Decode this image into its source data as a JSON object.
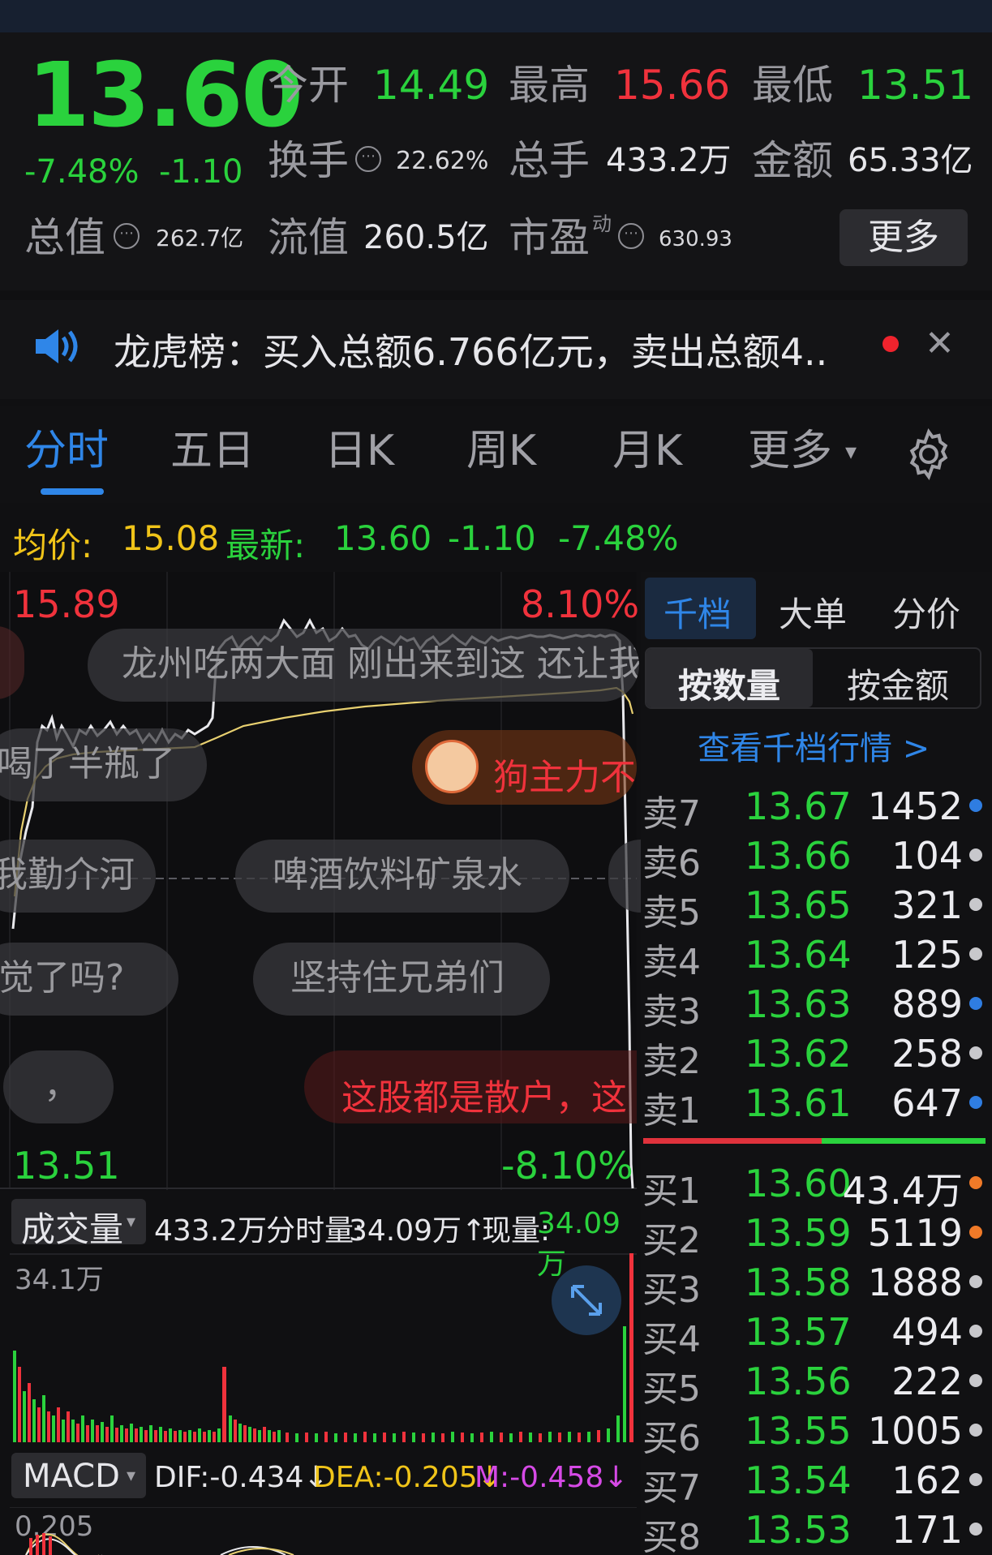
{
  "quote": {
    "price": "13.60",
    "change_pct": "-7.48%",
    "change_abs": "-1.10",
    "open_label": "今开",
    "open_value": "14.49",
    "high_label": "最高",
    "high_value": "15.66",
    "low_label": "最低",
    "low_value": "13.51",
    "turnover_label": "换手",
    "turnover_value": "22.62%",
    "volume_label": "总手",
    "volume_value": "433.2万",
    "amount_label": "金额",
    "amount_value": "65.33亿",
    "mktcap_label": "总值",
    "mktcap_value": "262.7亿",
    "float_label": "流值",
    "float_value": "260.5亿",
    "pe_label": "市盈",
    "pe_sup": "动",
    "pe_value": "630.93",
    "more_label": "更多",
    "info_glyph": "⋯"
  },
  "notice": {
    "text": "龙虎榜：买入总额6.766亿元，卖出总额4..",
    "close": "✕"
  },
  "tabs": [
    "分时",
    "五日",
    "日K",
    "周K",
    "月K",
    "更多"
  ],
  "tab_more_caret": "▾",
  "avg_row": {
    "avg_label": "均价:",
    "avg_value": "15.08",
    "latest_label": "最新:",
    "latest_value": "13.60",
    "latest_change": "-1.10",
    "latest_pct": "-7.48%"
  },
  "chart": {
    "top_price": "15.89",
    "top_pct": "8.10%",
    "bottom_price": "13.51",
    "bottom_pct": "-8.10%"
  },
  "danmaku": [
    "龙州吃两大面 刚出来到这 还让我",
    "喝了半瓶了",
    "狗主力不",
    "我勤介河",
    "啤酒饮料矿泉水",
    "觉了吗?",
    "坚持住兄弟们",
    "，",
    "这股都是散户，这"
  ],
  "volume": {
    "selector": "成交量",
    "caret": "▾",
    "total": "433.2万",
    "minute_label": "分时量:",
    "minute_value": "34.09万↑",
    "now_label": "现量:",
    "now_value": "34.09万",
    "axis_max": "34.1万"
  },
  "macd": {
    "selector": "MACD",
    "caret": "▾",
    "dif": "DIF:-0.434↓",
    "dea": "DEA:-0.205↓",
    "m": "M:-0.458↓",
    "axis_label": "0.205"
  },
  "orderbook": {
    "tabs": [
      "千档",
      "大单",
      "分价"
    ],
    "sub_tabs": [
      "按数量",
      "按金额"
    ],
    "view_link": "查看千档行情 >",
    "asks": [
      {
        "label": "卖7",
        "price": "13.67",
        "qty": "1452",
        "dot": "#2f7de1"
      },
      {
        "label": "卖6",
        "price": "13.66",
        "qty": "104",
        "dot": "#c8c8cc"
      },
      {
        "label": "卖5",
        "price": "13.65",
        "qty": "321",
        "dot": "#c8c8cc"
      },
      {
        "label": "卖4",
        "price": "13.64",
        "qty": "125",
        "dot": "#c8c8cc"
      },
      {
        "label": "卖3",
        "price": "13.63",
        "qty": "889",
        "dot": "#2f7de1"
      },
      {
        "label": "卖2",
        "price": "13.62",
        "qty": "258",
        "dot": "#c8c8cc"
      },
      {
        "label": "卖1",
        "price": "13.61",
        "qty": "647",
        "dot": "#2f7de1"
      }
    ],
    "bids": [
      {
        "label": "买1",
        "price": "13.60",
        "qty": "43.4万",
        "dot": "#f07a28"
      },
      {
        "label": "买2",
        "price": "13.59",
        "qty": "5119",
        "dot": "#f07a28"
      },
      {
        "label": "买3",
        "price": "13.58",
        "qty": "1888",
        "dot": "#c8c8cc"
      },
      {
        "label": "买4",
        "price": "13.57",
        "qty": "494",
        "dot": "#c8c8cc"
      },
      {
        "label": "买5",
        "price": "13.56",
        "qty": "222",
        "dot": "#c8c8cc"
      },
      {
        "label": "买6",
        "price": "13.55",
        "qty": "1005",
        "dot": "#c8c8cc"
      },
      {
        "label": "买7",
        "price": "13.54",
        "qty": "162",
        "dot": "#c8c8cc"
      },
      {
        "label": "买8",
        "price": "13.53",
        "qty": "171",
        "dot": "#c8c8cc"
      }
    ]
  }
}
